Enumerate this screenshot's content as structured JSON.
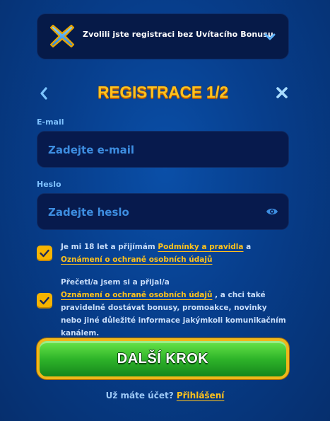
{
  "bonus": {
    "text": "Zvolili jste registraci bez Uvítacího Bonusu",
    "icon": "x-cross-icon",
    "expand_icon": "chevron-down-icon"
  },
  "header": {
    "title": "REGISTRACE 1/2",
    "back_icon": "chevron-left-icon",
    "close_icon": "close-icon"
  },
  "email": {
    "label": "E-mail",
    "placeholder": "Zadejte e-mail"
  },
  "password": {
    "label": "Heslo",
    "placeholder": "Zadejte heslo",
    "toggle_icon": "eye-icon"
  },
  "consents": [
    {
      "checked": true,
      "text_before": "Je mi 18 let a přijímám ",
      "link1": "Podmínky a pravidla",
      "text_mid": " a",
      "link2": "Oznámení o ochraně osobních údajů"
    },
    {
      "checked": true,
      "text_before": "Přečetl/a jsem si a přijal/a",
      "link1": "Oznámení o ochraně osobních údajů",
      "text_after": " , a chci také pravidelně dostávat bonusy, promoakce, novinky nebo jiné důležité informace jakýmkoli komunikačním kanálem."
    }
  ],
  "next_button": {
    "label": "DALŠÍ KROK"
  },
  "login": {
    "prompt": "Už máte účet? ",
    "link": "Přihlášení"
  },
  "colors": {
    "accent": "#ffc21c",
    "button_green": "#2fb52a",
    "field_bg": "#071a4d",
    "label_blue": "#7fc2ff"
  }
}
